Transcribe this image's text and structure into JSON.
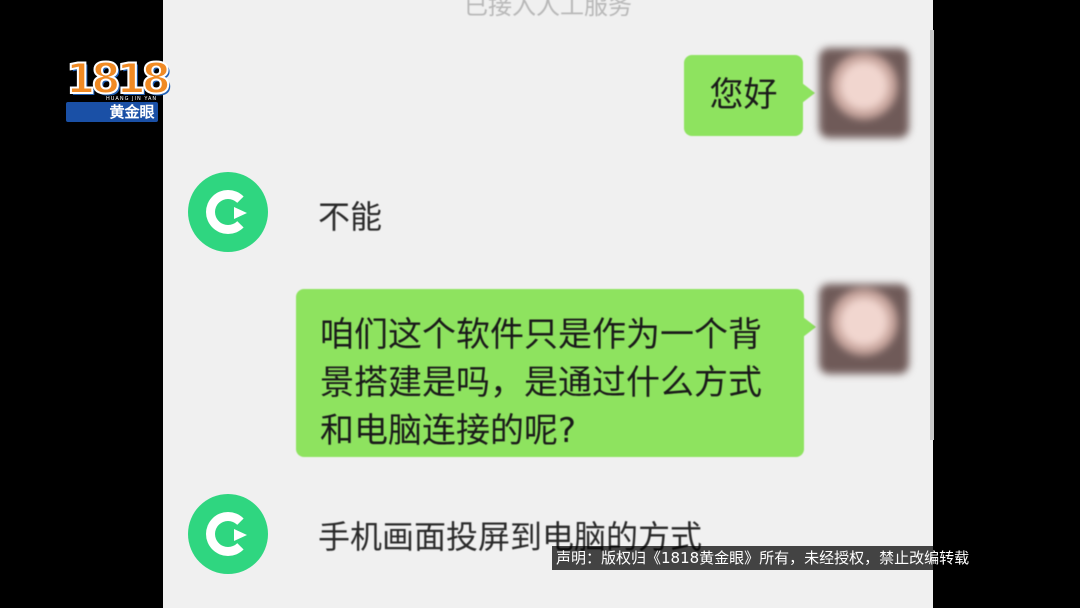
{
  "chat": {
    "system_note": "已接入人工服务",
    "messages": [
      {
        "side": "right",
        "text": "您好"
      },
      {
        "side": "left",
        "text": "不能"
      },
      {
        "side": "right",
        "lines": [
          "咱们这个软件只是作为一个背",
          "景搭建是吗，是通过什么方式",
          "和电脑连接的呢?"
        ]
      },
      {
        "side": "left",
        "text": "手机画面投屏到电脑的方式"
      }
    ]
  },
  "overlay": {
    "logo_digits": "1818",
    "logo_label": "黄金眼",
    "logo_sub": "HUANG JIN YAN",
    "caption": "声明：版权归《1818黄金眼》所有，未经授权，禁止改编转载"
  },
  "colors": {
    "outgoing_bubble": "#8ee35f",
    "bot_avatar": "#2fd680",
    "chat_background": "#f0f0f0"
  }
}
